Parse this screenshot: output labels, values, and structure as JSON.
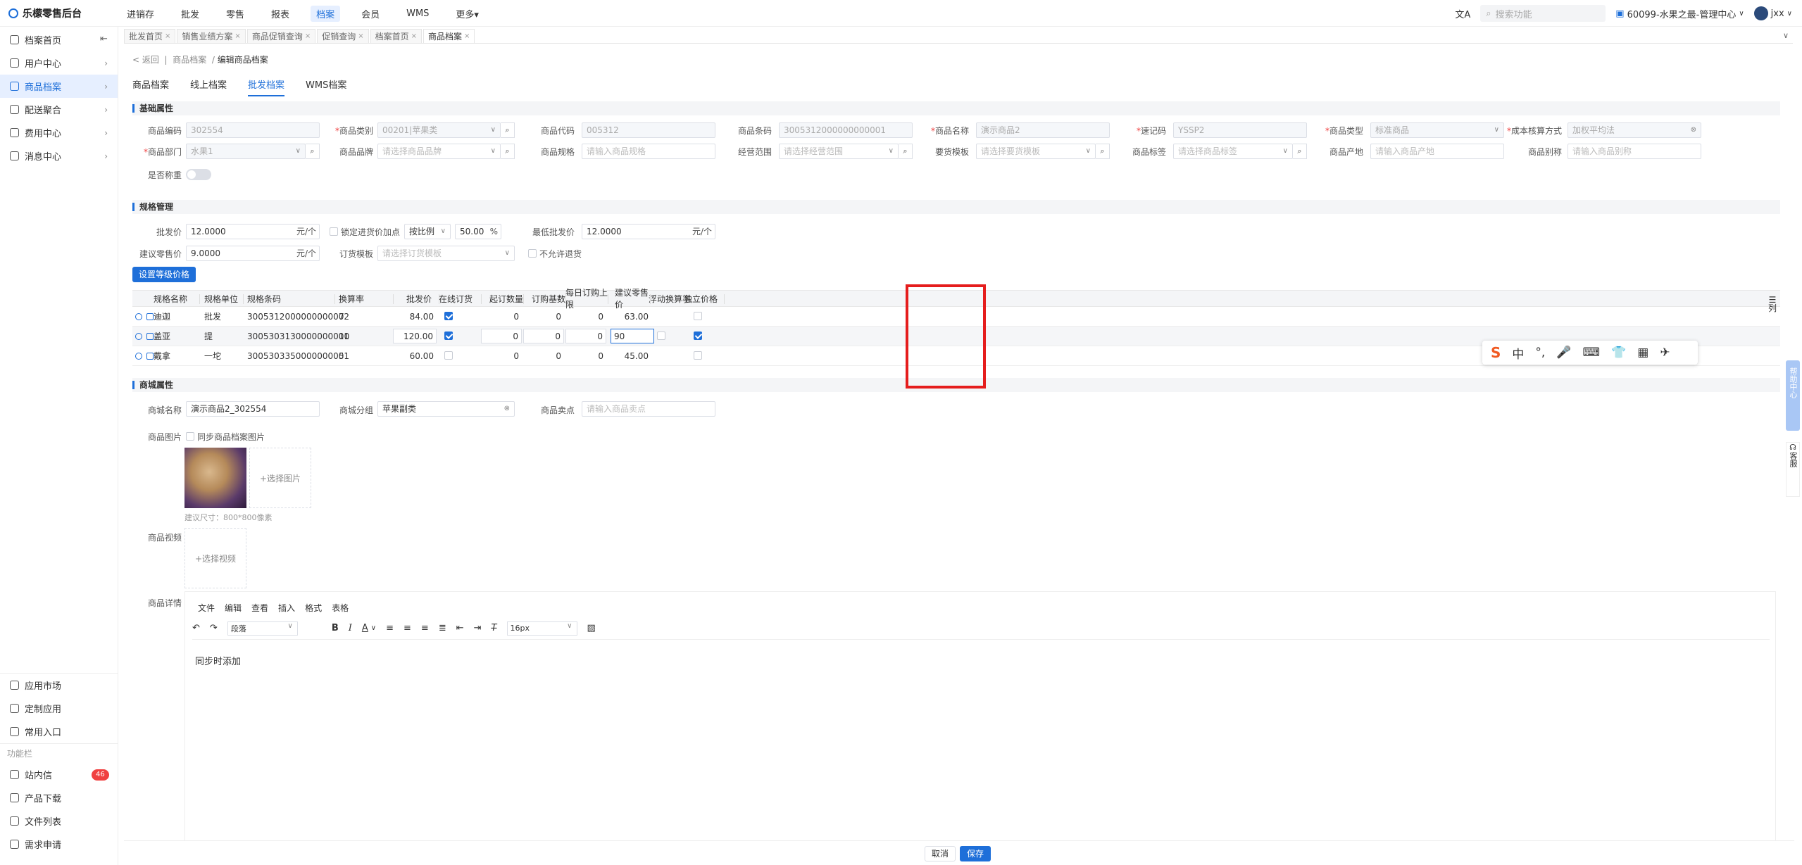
{
  "app": {
    "title": "乐檬零售后台"
  },
  "topnav": [
    "进销存",
    "批发",
    "零售",
    "报表",
    "档案",
    "会员",
    "WMS",
    "更多▾"
  ],
  "topnav_active": 4,
  "topbar": {
    "search_placeholder": "搜索功能",
    "store": "60099-水果之最-管理中心",
    "user": "jxx"
  },
  "sidebar": {
    "items": [
      {
        "label": "档案首页"
      },
      {
        "label": "用户中心"
      },
      {
        "label": "商品档案"
      },
      {
        "label": "配送聚合"
      },
      {
        "label": "费用中心"
      },
      {
        "label": "消息中心"
      }
    ],
    "bottom": [
      {
        "label": "应用市场"
      },
      {
        "label": "定制应用"
      },
      {
        "label": "常用入口"
      }
    ],
    "group": "功能栏",
    "tools": [
      {
        "label": "站内信",
        "badge": "46"
      },
      {
        "label": "产品下载"
      },
      {
        "label": "文件列表"
      },
      {
        "label": "需求申请"
      }
    ]
  },
  "tabs": [
    "批发首页",
    "销售业绩方案",
    "商品促销查询",
    "促销查询",
    "档案首页",
    "商品档案"
  ],
  "breadcrumb": {
    "back": "返回",
    "parent": "商品档案",
    "current": "编辑商品档案"
  },
  "subtabs": [
    "商品档案",
    "线上档案",
    "批发档案",
    "WMS档案"
  ],
  "subtabs_active": 2,
  "sections": {
    "basic": "基础属性",
    "spec": "规格管理",
    "mall": "商城属性"
  },
  "basic": {
    "code_label": "商品编码",
    "code": "302554",
    "category_label": "商品类别",
    "category": "00201|苹果类",
    "daima_label": "商品代码",
    "daima": "005312",
    "barcode_label": "商品条码",
    "barcode": "3005312000000000001",
    "name_label": "商品名称",
    "name": "演示商品2",
    "quick_label": "速记码",
    "quick": "YSSP2",
    "type_label": "商品类型",
    "type": "标准商品",
    "cost_label": "成本核算方式",
    "cost": "加权平均法",
    "dept_label": "商品部门",
    "dept": "水果1",
    "brand_label": "商品品牌",
    "brand_ph": "请选择商品品牌",
    "spec_label": "商品规格",
    "spec_ph": "请输入商品规格",
    "scope_label": "经营范围",
    "scope_ph": "请选择经营范围",
    "tpl_label": "要货模板",
    "tpl_ph": "请选择要货模板",
    "tag_label": "商品标签",
    "tag_ph": "请选择商品标签",
    "origin_label": "商品产地",
    "origin_ph": "请输入商品产地",
    "alias_label": "商品别称",
    "alias_ph": "请输入商品别称",
    "weigh_label": "是否称重"
  },
  "spec": {
    "wholesale_label": "批发价",
    "wholesale": "12.0000",
    "unit": "元/个",
    "lock_label": "锁定进货价加点",
    "ratio": "按比例",
    "percent": "50.00",
    "pct": "%",
    "min_label": "最低批发价",
    "min": "12.0000",
    "retail_label": "建议零售价",
    "retail": "9.0000",
    "order_tpl_label": "订货模板",
    "order_tpl_ph": "请选择订货模板",
    "no_return_label": "不允许退货",
    "level_btn": "设置等级价格"
  },
  "table": {
    "headers": [
      "规格名称",
      "规格单位",
      "规格条码",
      "换算率",
      "批发价",
      "在线订货",
      "起订数量",
      "订购基数",
      "每日订购上限",
      "建议零售价",
      "浮动换算率",
      "独立价格"
    ],
    "rows": [
      {
        "name": "迪迦",
        "unit": "批发",
        "barcode": "3005312000000000002",
        "rate": "7",
        "price": "84.00",
        "online": true,
        "min": "0",
        "base": "0",
        "limit": "0",
        "retail": "63.00",
        "independent": false
      },
      {
        "name": "盖亚",
        "unit": "提",
        "barcode": "3005303130000000001",
        "rate": "10",
        "price": "120.00",
        "online": true,
        "min": "0",
        "base": "0",
        "limit": "0",
        "retail": "90",
        "independent": true
      },
      {
        "name": "戴拿",
        "unit": "一坨",
        "barcode": "3005303350000000001",
        "rate": "5",
        "price": "60.00",
        "online": false,
        "min": "0",
        "base": "0",
        "limit": "0",
        "retail": "45.00",
        "independent": false
      }
    ],
    "column_toggle": "列"
  },
  "mall": {
    "name_label": "商城名称",
    "name": "演示商品2_302554",
    "group_label": "商城分组",
    "group": "苹果副类",
    "selling_label": "商品卖点",
    "selling_ph": "请输入商品卖点",
    "image_label": "商品图片",
    "sync_label": "同步商品档案图片",
    "choose_image": "+选择图片",
    "size_hint": "建议尺寸：800*800像素",
    "video_label": "商品视频",
    "choose_video": "+选择视频",
    "detail_label": "商品详情"
  },
  "editor": {
    "menu": [
      "文件",
      "编辑",
      "查看",
      "插入",
      "格式",
      "表格"
    ],
    "paragraph": "段落",
    "fontsize": "16px",
    "content": "同步时添加"
  },
  "footer": {
    "cancel": "取消",
    "save": "保存"
  },
  "ime": [
    "S",
    "中",
    "°,",
    "🎤",
    "⌨",
    "👕",
    "▦",
    "✈"
  ],
  "rightside": {
    "service": "客服",
    "help": "帮助中心"
  }
}
